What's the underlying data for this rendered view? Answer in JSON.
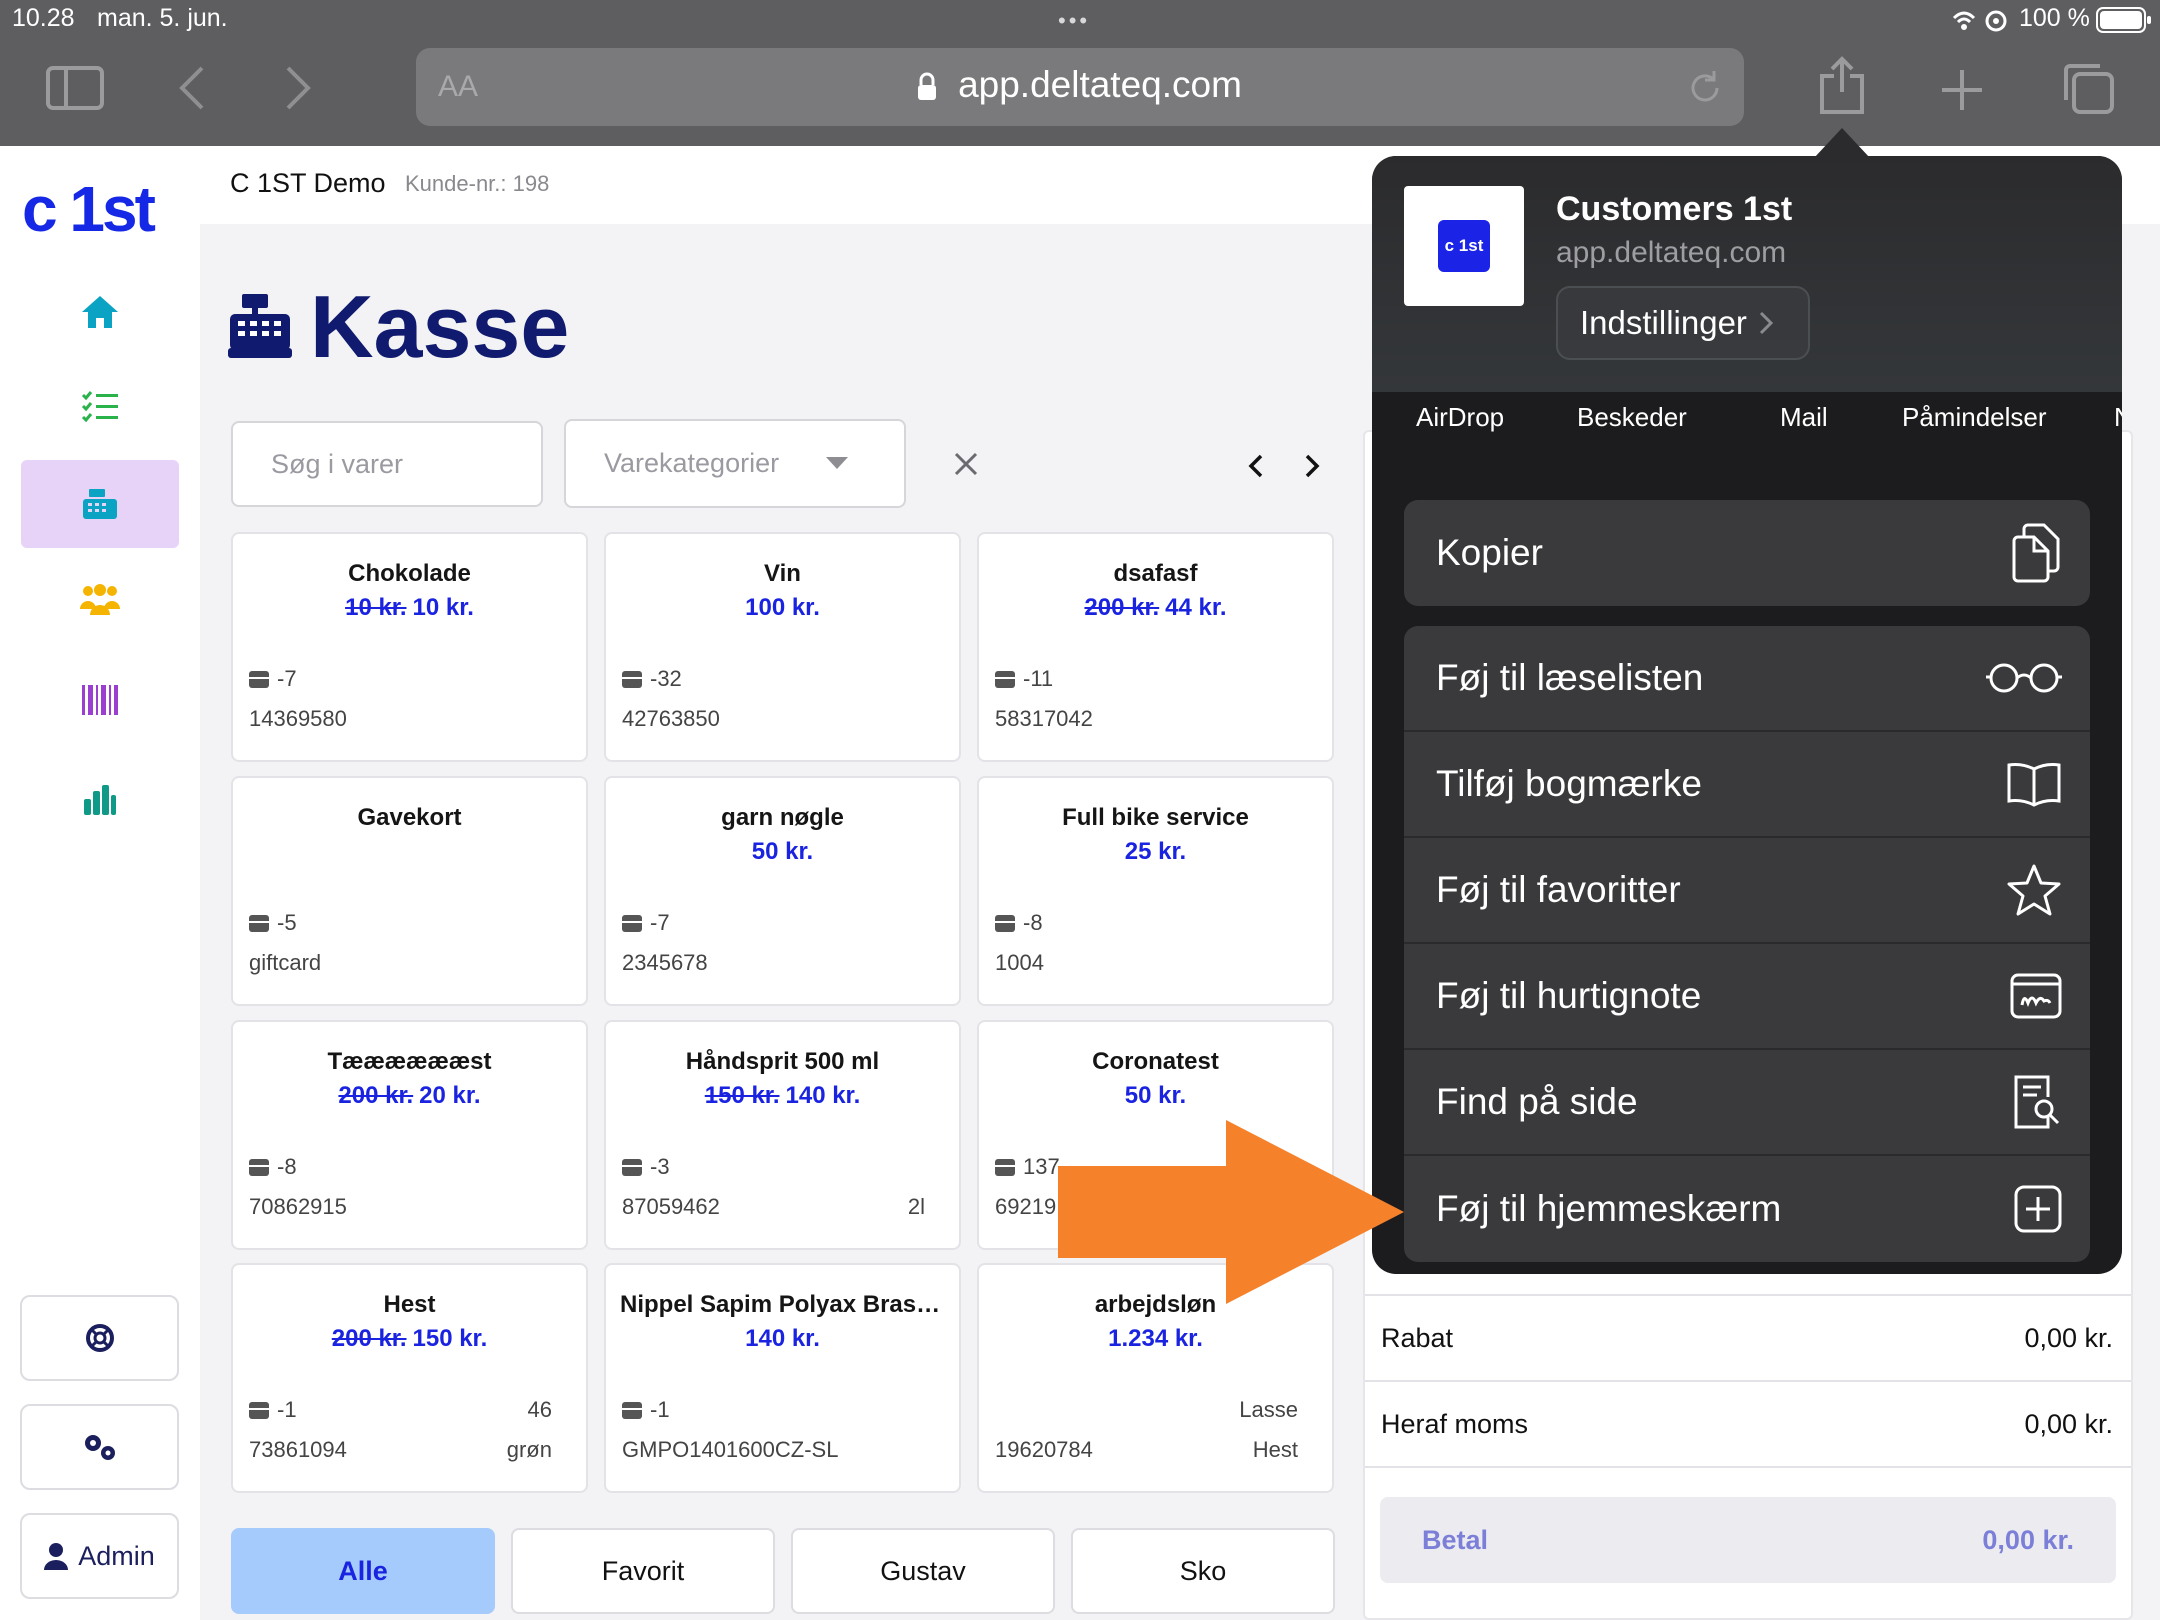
{
  "status_bar": {
    "time": "10.28",
    "date": "man. 5. jun.",
    "battery": "100 %"
  },
  "browser": {
    "aa_label": "AA",
    "url": "app.deltateq.com"
  },
  "app": {
    "logo": "c 1st",
    "customer_name": "C 1ST Demo",
    "customer_no": "Kunde-nr.: 198",
    "page_title": "Kasse",
    "admin_label": "Admin"
  },
  "toolbar": {
    "search_placeholder": "Søg i varer",
    "category_placeholder": "Varekategorier"
  },
  "products": [
    {
      "name": "Chokolade",
      "old_price": "10 kr.",
      "price": "10 kr.",
      "stock": "-7",
      "sku": "14369580",
      "extra1": "",
      "extra2": ""
    },
    {
      "name": "Vin",
      "old_price": "",
      "price": "100 kr.",
      "stock": "-32",
      "sku": "42763850",
      "extra1": "",
      "extra2": ""
    },
    {
      "name": "dsafasf",
      "old_price": "200 kr.",
      "price": "44 kr.",
      "stock": "-11",
      "sku": "58317042",
      "extra1": "",
      "extra2": ""
    },
    {
      "name": "Gavekort",
      "old_price": "",
      "price": "",
      "stock": "-5",
      "sku": "giftcard",
      "extra1": "",
      "extra2": ""
    },
    {
      "name": "garn nøgle",
      "old_price": "",
      "price": "50 kr.",
      "stock": "-7",
      "sku": "2345678",
      "extra1": "",
      "extra2": ""
    },
    {
      "name": "Full bike service",
      "old_price": "",
      "price": "25 kr.",
      "stock": "-8",
      "sku": "1004",
      "extra1": "",
      "extra2": ""
    },
    {
      "name": "Tææææææst",
      "old_price": "200 kr.",
      "price": "20 kr.",
      "stock": "-8",
      "sku": "70862915",
      "extra1": "",
      "extra2": ""
    },
    {
      "name": "Håndsprit 500 ml",
      "old_price": "150 kr.",
      "price": "140 kr.",
      "stock": "-3",
      "sku": "87059462",
      "extra1": "",
      "extra2": "2l"
    },
    {
      "name": "Coronatest",
      "old_price": "",
      "price": "50 kr.",
      "stock": "137",
      "sku": "69219",
      "extra1": "",
      "extra2": ""
    },
    {
      "name": "Hest",
      "old_price": "200 kr.",
      "price": "150 kr.",
      "stock": "-1",
      "sku": "73861094",
      "extra1": "46",
      "extra2": "grøn"
    },
    {
      "name": "Nippel Sapim Polyax Brass...",
      "old_price": "",
      "price": "140 kr.",
      "stock": "-1",
      "sku": "GMPO1401600CZ-SL",
      "extra1": "",
      "extra2": ""
    },
    {
      "name": "arbejdsløn",
      "old_price": "",
      "price": "1.234 kr.",
      "stock": "",
      "sku": "19620784",
      "extra1": "Lasse",
      "extra2": "Hest"
    }
  ],
  "tabs": [
    {
      "label": "Alle",
      "active": true
    },
    {
      "label": "Favorit",
      "active": false
    },
    {
      "label": "Gustav",
      "active": false
    },
    {
      "label": "Sko",
      "active": false
    }
  ],
  "cart": {
    "discount_label": "Rabat",
    "discount_value": "0,00 kr.",
    "vat_label": "Heraf moms",
    "vat_value": "0,00 kr.",
    "pay_label": "Betal",
    "pay_value": "0,00 kr."
  },
  "share_sheet": {
    "app_icon_text": "c 1st",
    "title": "Customers 1st",
    "subtitle": "app.deltateq.com",
    "settings_label": "Indstillinger",
    "apps": [
      "AirDrop",
      "Beskeder",
      "Mail",
      "Påmindelser"
    ],
    "actions": {
      "copy": "Kopier",
      "reading_list": "Føj til læselisten",
      "bookmark": "Tilføj bogmærke",
      "favorites": "Føj til favoritter",
      "quick_note": "Føj til hurtignote",
      "find": "Find på side",
      "home_screen": "Føj til hjemmeskærm"
    }
  },
  "colors": {
    "brand": "#1428e6",
    "price": "#1a23e0",
    "highlight_arrow": "#f5812a",
    "active_nav": "#e7d3f8",
    "active_tab": "#a5cbfc"
  },
  "icons": [
    "home-icon",
    "checklist-icon",
    "register-icon",
    "users-icon",
    "barcode-icon",
    "chart-icon",
    "lifebuoy-icon",
    "gears-icon",
    "user-icon",
    "lock-icon",
    "reload-icon",
    "share-icon",
    "plus-icon",
    "tabs-icon"
  ]
}
